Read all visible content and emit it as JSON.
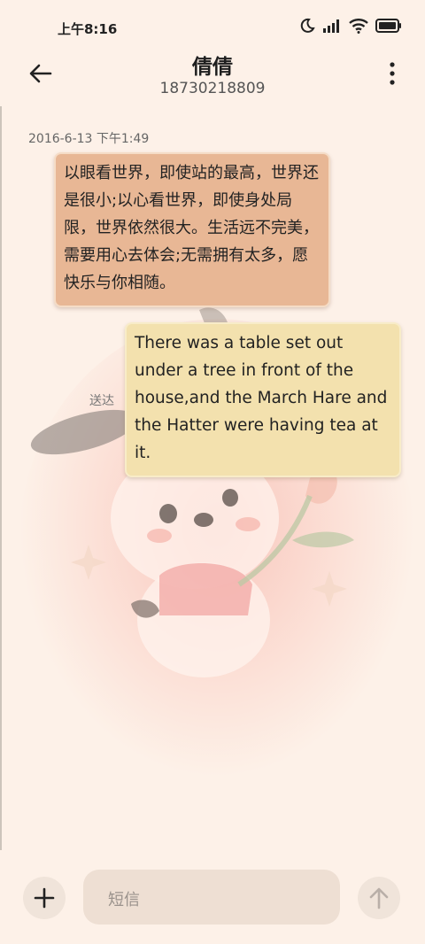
{
  "status_bar": {
    "time": "上午8:16"
  },
  "header": {
    "contact_name": "倩倩",
    "phone_number": "18730218809"
  },
  "conversation": {
    "timestamp": "2016-6-13 下午1:49",
    "messages": [
      {
        "direction": "incoming",
        "text": "以眼看世界，即使站的最高，世界还是很小;以心看世界，即使身处局限，世界依然很大。生活远不完美，需要用心去体会;无需拥有太多，愿快乐与你相随。"
      },
      {
        "direction": "outgoing",
        "text": "There was a table set out under a tree in front of the house,and the March Hare and the Hatter were having tea at it."
      }
    ],
    "status_label": "送达"
  },
  "composer": {
    "placeholder": "短信"
  },
  "colors": {
    "background": "#fdf1e8",
    "incoming_bubble": "#e8b795",
    "outgoing_bubble": "#f3e1ae"
  },
  "icons": [
    "moon-icon",
    "signal-icon",
    "wifi-icon",
    "battery-icon",
    "back-arrow-icon",
    "more-vert-icon",
    "plus-icon",
    "send-arrow-icon"
  ]
}
